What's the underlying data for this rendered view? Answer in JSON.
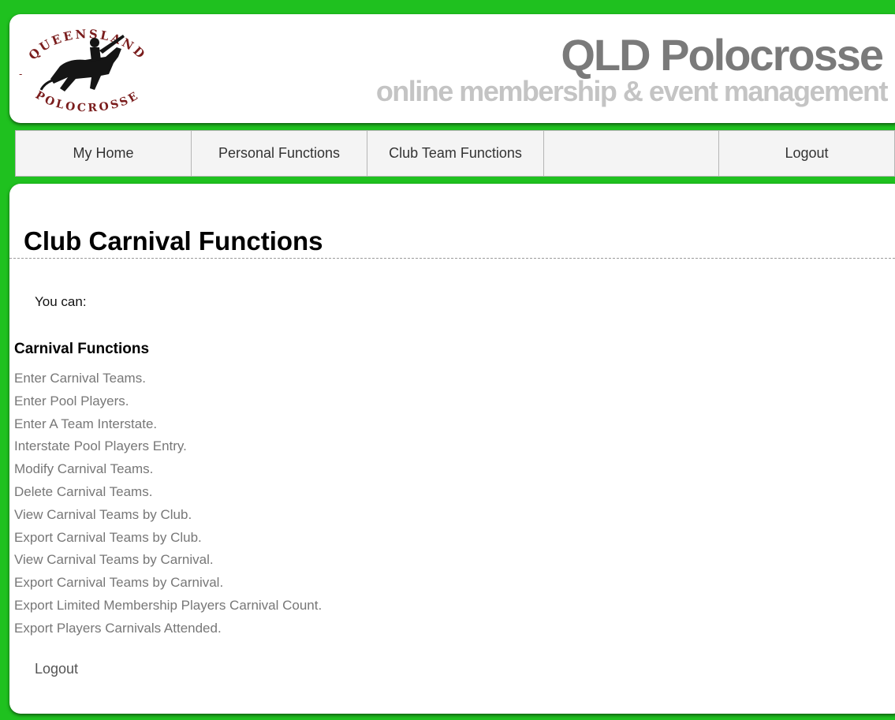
{
  "header": {
    "logo": {
      "text_top": "QUEENSLAND",
      "text_bottom": "POLOCROSSE",
      "icon": "horse-rider-logo"
    },
    "title": "QLD Polocrosse",
    "subtitle": "online membership & event management"
  },
  "nav": {
    "items": [
      {
        "label": "My Home"
      },
      {
        "label": "Personal Functions"
      },
      {
        "label": "Club Team Functions"
      },
      {
        "label": ""
      },
      {
        "label": "Logout"
      }
    ]
  },
  "main": {
    "page_title": "Club Carnival Functions",
    "intro": "You can:",
    "section_heading": "Carnival Functions",
    "functions": [
      "Enter Carnival Teams.",
      "Enter Pool Players.",
      "Enter A Team Interstate.",
      "Interstate Pool Players Entry.",
      "Modify Carnival Teams.",
      "Delete Carnival Teams.",
      "View Carnival Teams by Club.",
      "Export Carnival Teams by Club.",
      "View Carnival Teams by Carnival.",
      "Export Carnival Teams by Carnival.",
      "Export Limited Membership Players Carnival Count.",
      "Export Players Carnivals Attended."
    ],
    "logout_link": "Logout"
  },
  "colors": {
    "page_background": "#1fc11f",
    "logo_maroon": "#7a1c1c",
    "title_gray": "#7a7a7a",
    "subtitle_gray": "#c4c4c4",
    "link_gray": "#777777"
  }
}
